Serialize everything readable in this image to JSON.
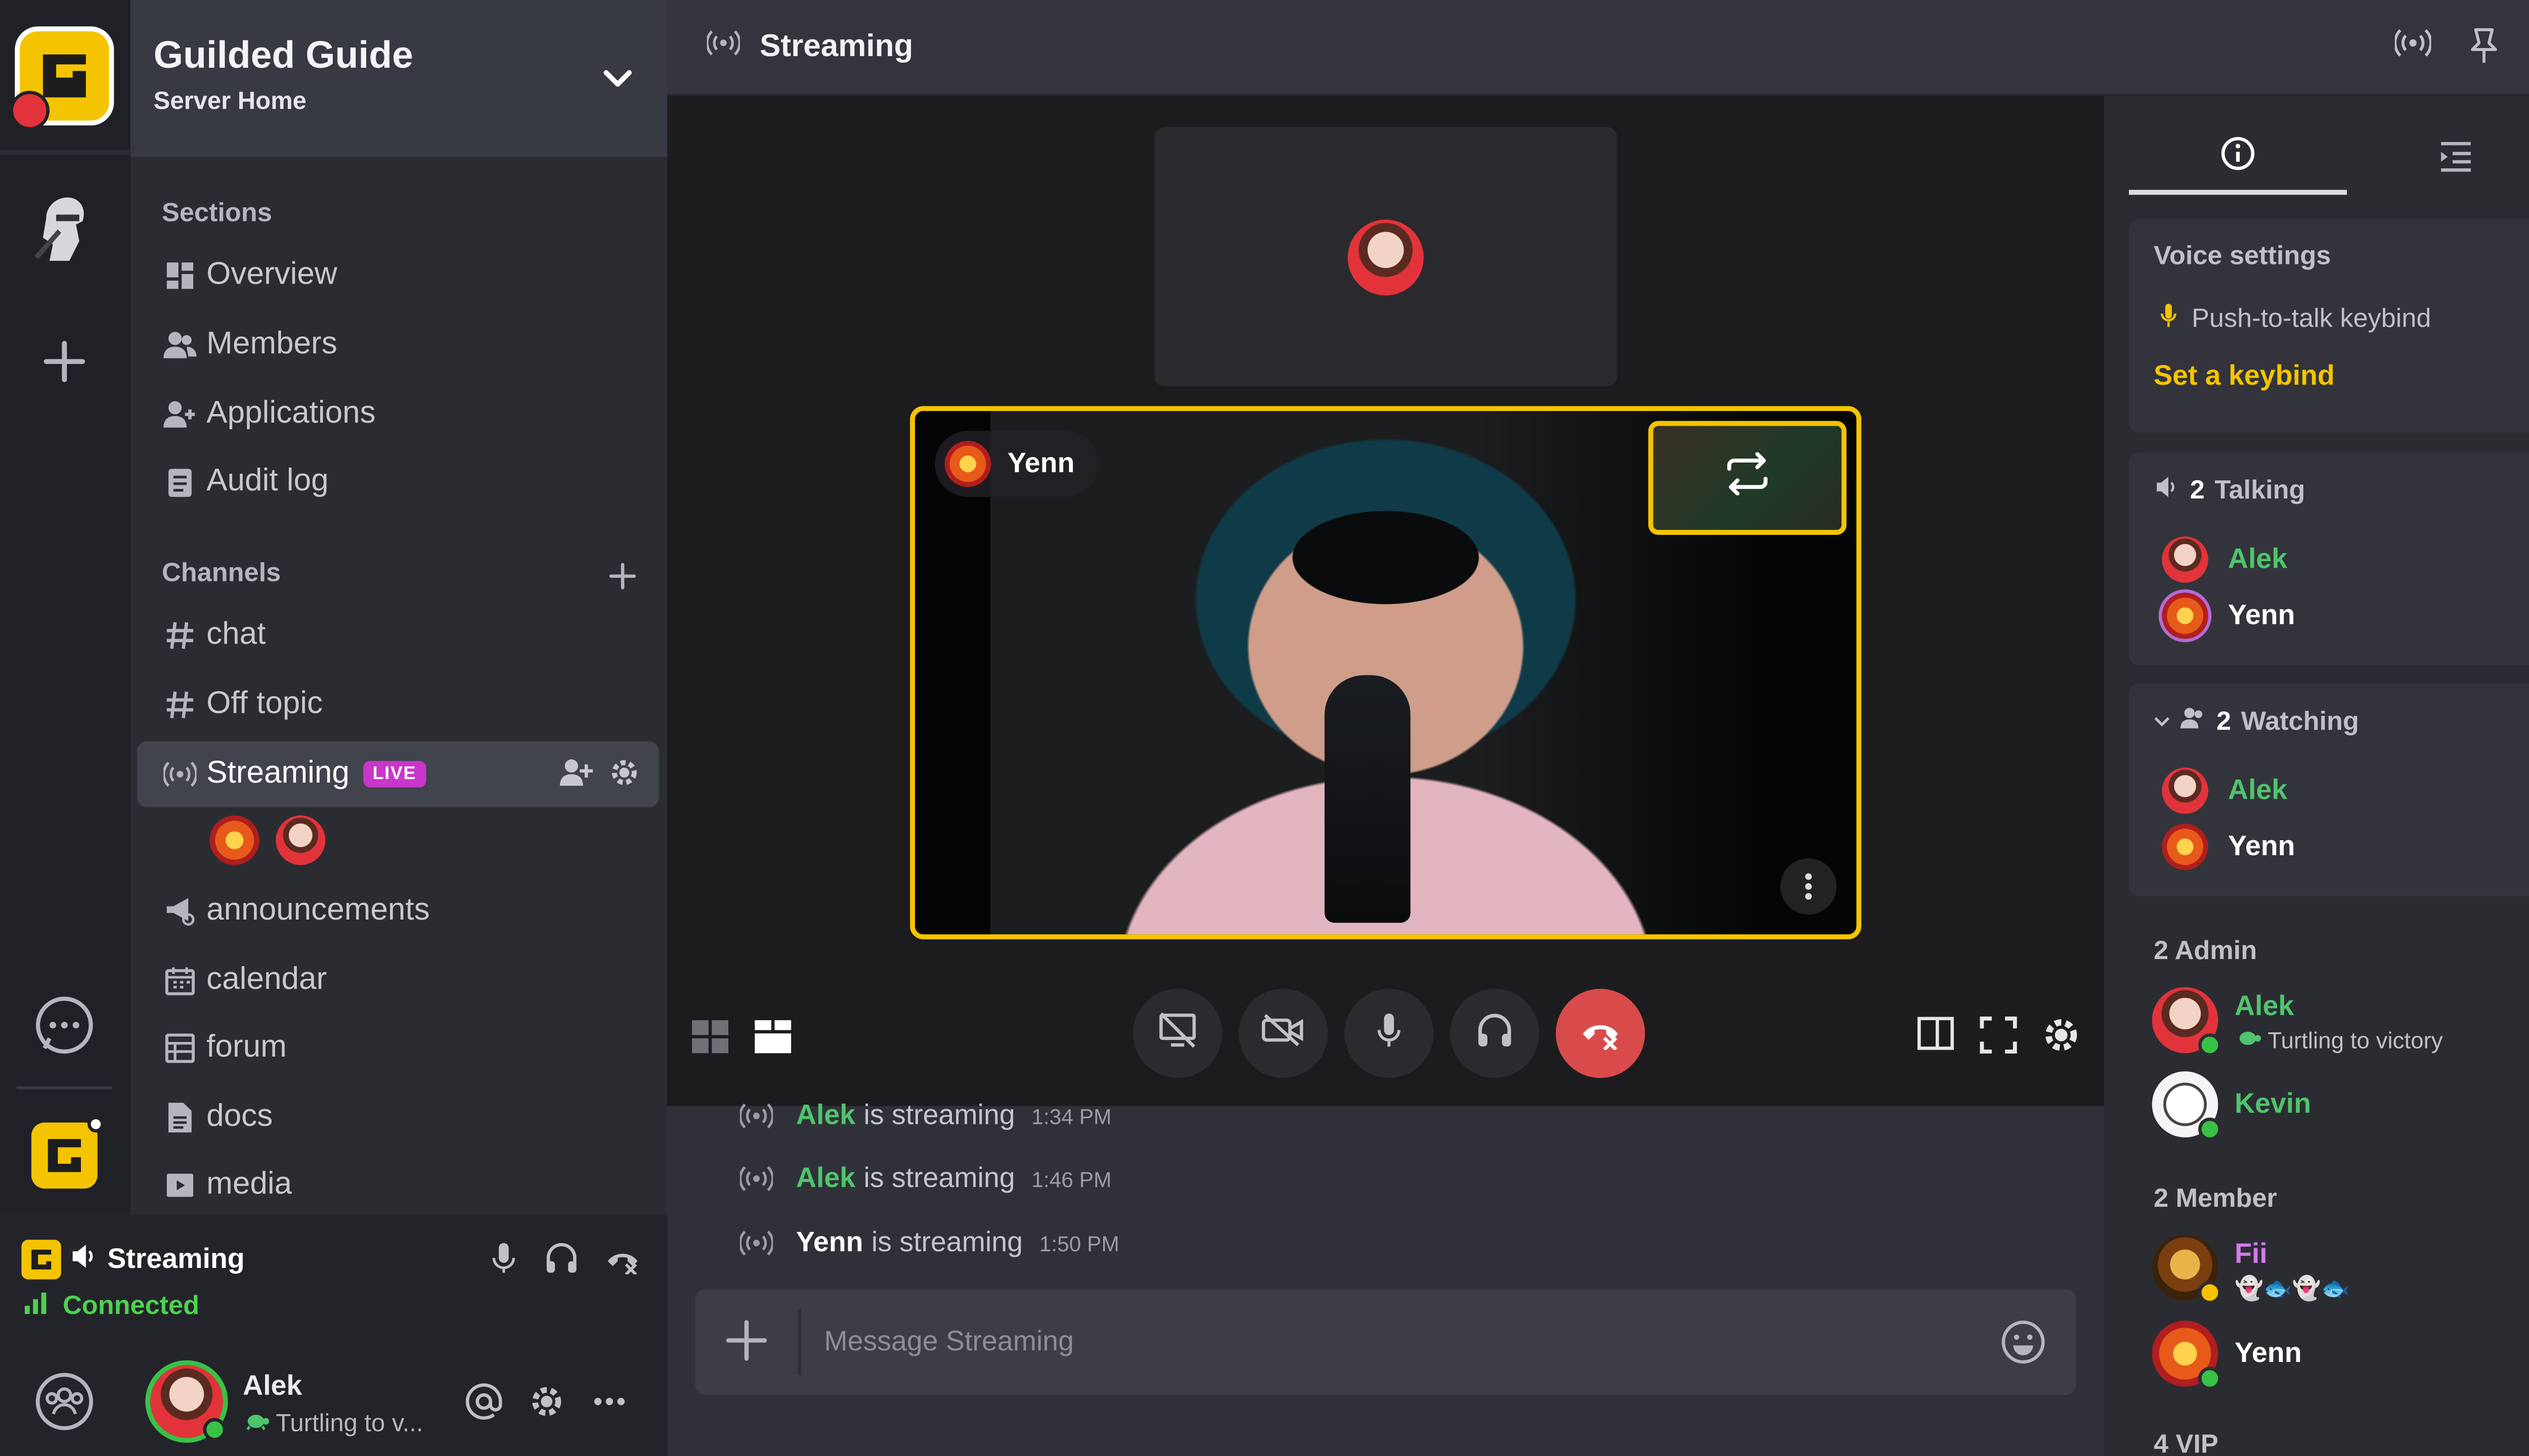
{
  "server": {
    "name": "Guilded Guide",
    "subtitle": "Server Home"
  },
  "sidebar": {
    "sections_label": "Sections",
    "sections": [
      {
        "label": "Overview",
        "icon": "grid-icon"
      },
      {
        "label": "Members",
        "icon": "members-icon"
      },
      {
        "label": "Applications",
        "icon": "applications-icon"
      },
      {
        "label": "Audit log",
        "icon": "clipboard-icon"
      }
    ],
    "channels_label": "Channels",
    "channels": [
      {
        "label": "chat",
        "icon": "hash-icon"
      },
      {
        "label": "Off topic",
        "icon": "hash-icon"
      },
      {
        "label": "Streaming",
        "icon": "broadcast-icon",
        "badge": "LIVE",
        "active": true
      },
      {
        "label": "announcements",
        "icon": "megaphone-icon"
      },
      {
        "label": "calendar",
        "icon": "calendar-icon"
      },
      {
        "label": "forum",
        "icon": "forum-icon"
      },
      {
        "label": "docs",
        "icon": "doc-icon"
      },
      {
        "label": "media",
        "icon": "media-icon"
      }
    ]
  },
  "voice": {
    "channel": "Streaming",
    "status": "Connected"
  },
  "user": {
    "name": "Alek",
    "status": "Turtling to v..."
  },
  "topbar": {
    "title": "Streaming"
  },
  "stream": {
    "main_label": "Yenn"
  },
  "messages": [
    {
      "who": "Alek",
      "text": "is streaming",
      "time": "1:34 PM"
    },
    {
      "who": "Alek",
      "text": "is streaming",
      "time": "1:46 PM"
    },
    {
      "who": "Yenn",
      "text": "is streaming",
      "time": "1:50 PM"
    }
  ],
  "composer": {
    "placeholder": "Message Streaming"
  },
  "rpanel": {
    "voice_settings": {
      "title": "Voice settings",
      "ptt_label": "Push-to-talk keybind",
      "set_keybind": "Set a keybind"
    },
    "talking": {
      "count": "2",
      "label": "Talking",
      "users": [
        "Alek",
        "Yenn"
      ]
    },
    "watching": {
      "count": "2",
      "label": "Watching",
      "users": [
        "Alek",
        "Yenn"
      ]
    },
    "admin": {
      "header": "2 Admin"
    },
    "member": {
      "header": "2 Member"
    },
    "vip": {
      "header": "4 VIP"
    },
    "members": [
      {
        "name": "Alek",
        "status": "Turtling to victory"
      },
      {
        "name": "Kevin"
      },
      {
        "name": "Fii",
        "status": "👻🐟👻🐟"
      },
      {
        "name": "Yenn"
      }
    ]
  },
  "colors": {
    "accent": "#f5c400",
    "live": "#c936c9",
    "online": "#39c146",
    "end_call": "#d94b4b",
    "name_green": "#4fc46c"
  }
}
